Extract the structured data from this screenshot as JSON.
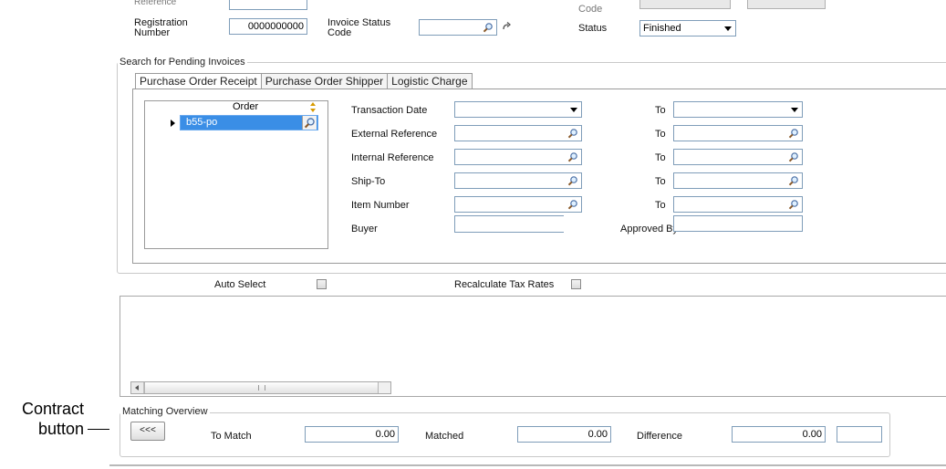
{
  "annotation": {
    "line1": "Contract",
    "line2": "button"
  },
  "header": {
    "reference_label": "Reference",
    "registration_number_label": "Registration Number",
    "registration_number_value": "0000000000",
    "invoice_status_code_label": "Invoice Status Code",
    "code_label": "Code",
    "status_label": "Status",
    "status_value": "Finished"
  },
  "search": {
    "title": "Search for Pending Invoices",
    "tabs": [
      "Purchase Order Receipt",
      "Purchase Order Shipper",
      "Logistic Charge"
    ],
    "active_tab": 0,
    "grid": {
      "column_header": "Order",
      "rows": [
        "b55-po"
      ]
    },
    "filters": [
      {
        "label": "Transaction Date",
        "kind": "dropdown",
        "to_label": "To"
      },
      {
        "label": "External Reference",
        "kind": "lookup",
        "to_label": "To"
      },
      {
        "label": "Internal Reference",
        "kind": "lookup",
        "to_label": "To"
      },
      {
        "label": "Ship-To",
        "kind": "lookup",
        "to_label": "To"
      },
      {
        "label": "Item Number",
        "kind": "lookup",
        "to_label": "To"
      },
      {
        "label": "Buyer",
        "kind": "text",
        "to_label": "Approved By"
      }
    ]
  },
  "options": {
    "auto_select_label": "Auto Select",
    "recalculate_label": "Recalculate Tax Rates"
  },
  "matching": {
    "title": "Matching Overview",
    "contract_button_label": "<<<",
    "to_match_label": "To Match",
    "to_match_value": "0.00",
    "matched_label": "Matched",
    "matched_value": "0.00",
    "difference_label": "Difference",
    "difference_value": "0.00"
  },
  "colors": {
    "selection": "#3a8ee6",
    "border": "#7f9db9",
    "sort_arrow": "#d79a00"
  }
}
